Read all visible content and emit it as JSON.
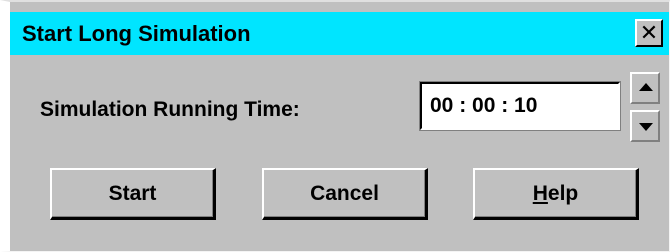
{
  "window": {
    "title": "Start Long Simulation",
    "close_label": "✕"
  },
  "form": {
    "running_time_label": "Simulation Running Time:",
    "running_time_value": "00 : 00 : 10"
  },
  "buttons": {
    "start_label": "Start",
    "cancel_label": "Cancel",
    "help_mnemonic": "H",
    "help_rest": "elp"
  },
  "icons": {
    "close": "close-icon",
    "spin_up": "arrow-up-icon",
    "spin_down": "arrow-down-icon"
  },
  "colors": {
    "titlebar": "#00e5ff",
    "dialog_face": "#c0c0c0"
  }
}
